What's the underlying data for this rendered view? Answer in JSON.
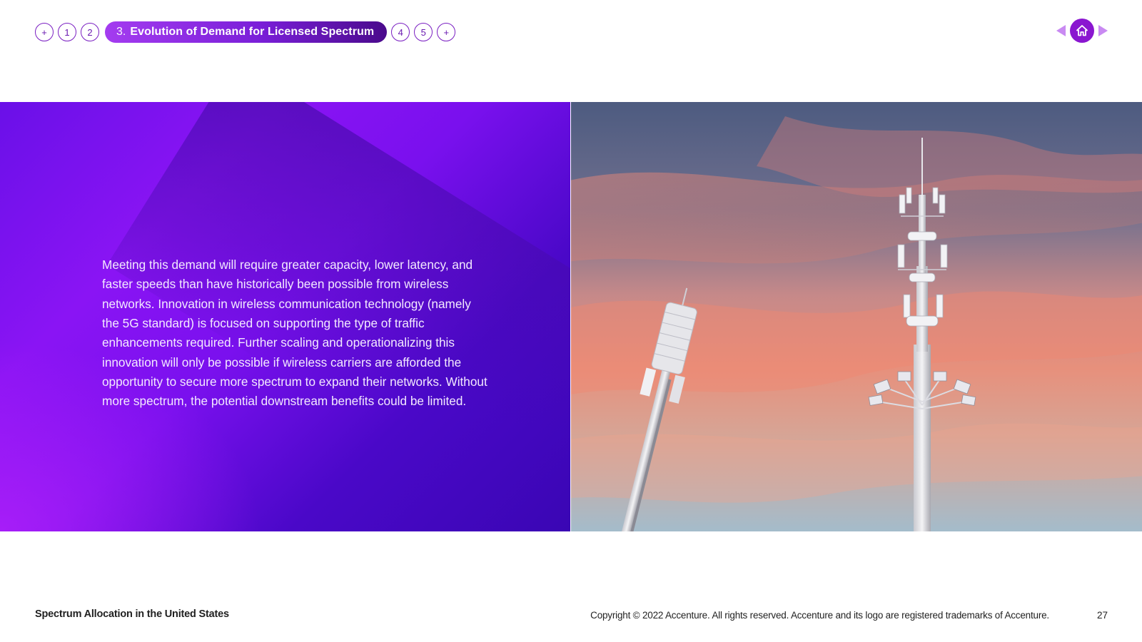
{
  "nav": {
    "items": [
      {
        "label": "+"
      },
      {
        "label": "1"
      },
      {
        "label": "2"
      },
      {
        "label": "3.",
        "title": "Evolution of Demand for Licensed Spectrum",
        "active": true
      },
      {
        "label": "4"
      },
      {
        "label": "5"
      },
      {
        "label": "+"
      }
    ]
  },
  "pager": {
    "prev_icon": "triangle-left-icon",
    "home_icon": "home-icon",
    "next_icon": "triangle-right-icon"
  },
  "content": {
    "body": "Meeting this demand will require greater capacity, lower latency, and faster speeds than have historically been possible from wireless networks. Innovation in wireless communication technology (namely the 5G standard) is focused on supporting the type of traffic enhancements required. Further scaling and operationalizing this innovation will only be possible if wireless carriers are afforded the opportunity to secure more spectrum to expand their networks. Without more spectrum, the potential downstream benefits could be limited."
  },
  "footer": {
    "doc_title": "Spectrum Allocation in the United States",
    "copyright": "Copyright © 2022 Accenture. All rights reserved. Accenture and its logo are registered trademarks of Accenture.",
    "page_number": "27"
  },
  "colors": {
    "accent": "#8a16d0",
    "nav_outline": "#7a1fc2",
    "arrow": "#c98af2"
  }
}
